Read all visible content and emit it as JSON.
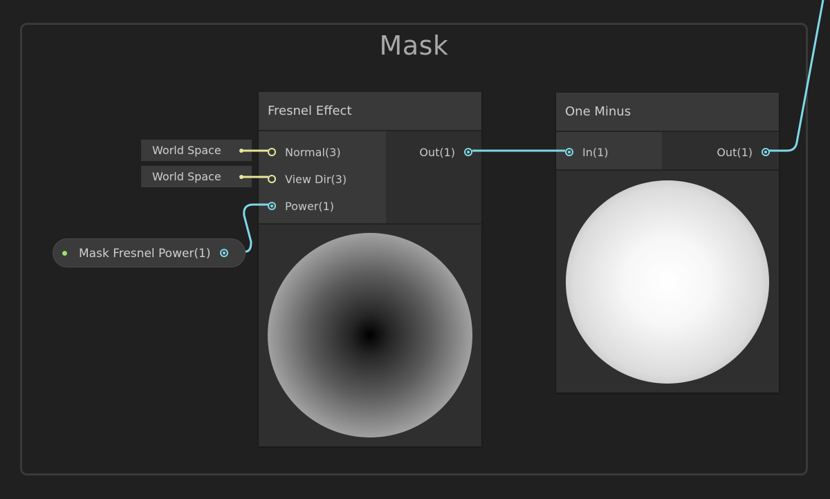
{
  "group": {
    "title": "Mask"
  },
  "fresnel_node": {
    "title": "Fresnel Effect",
    "inputs": [
      {
        "label": "Normal(3)"
      },
      {
        "label": "View Dir(3)"
      },
      {
        "label": "Power(1)"
      }
    ],
    "output": {
      "label": "Out(1)"
    }
  },
  "one_minus_node": {
    "title": "One Minus",
    "input": {
      "label": "In(1)"
    },
    "output": {
      "label": "Out(1)"
    }
  },
  "normal_space": {
    "value": "World Space"
  },
  "view_dir_space": {
    "value": "World Space"
  },
  "property_node": {
    "label": "Mask Fresnel Power(1)"
  },
  "colors": {
    "background": "#202020",
    "wire_vector1": "#7fd9e8",
    "wire_vector3": "#e9e79a",
    "property_dot": "#9ee06a"
  }
}
